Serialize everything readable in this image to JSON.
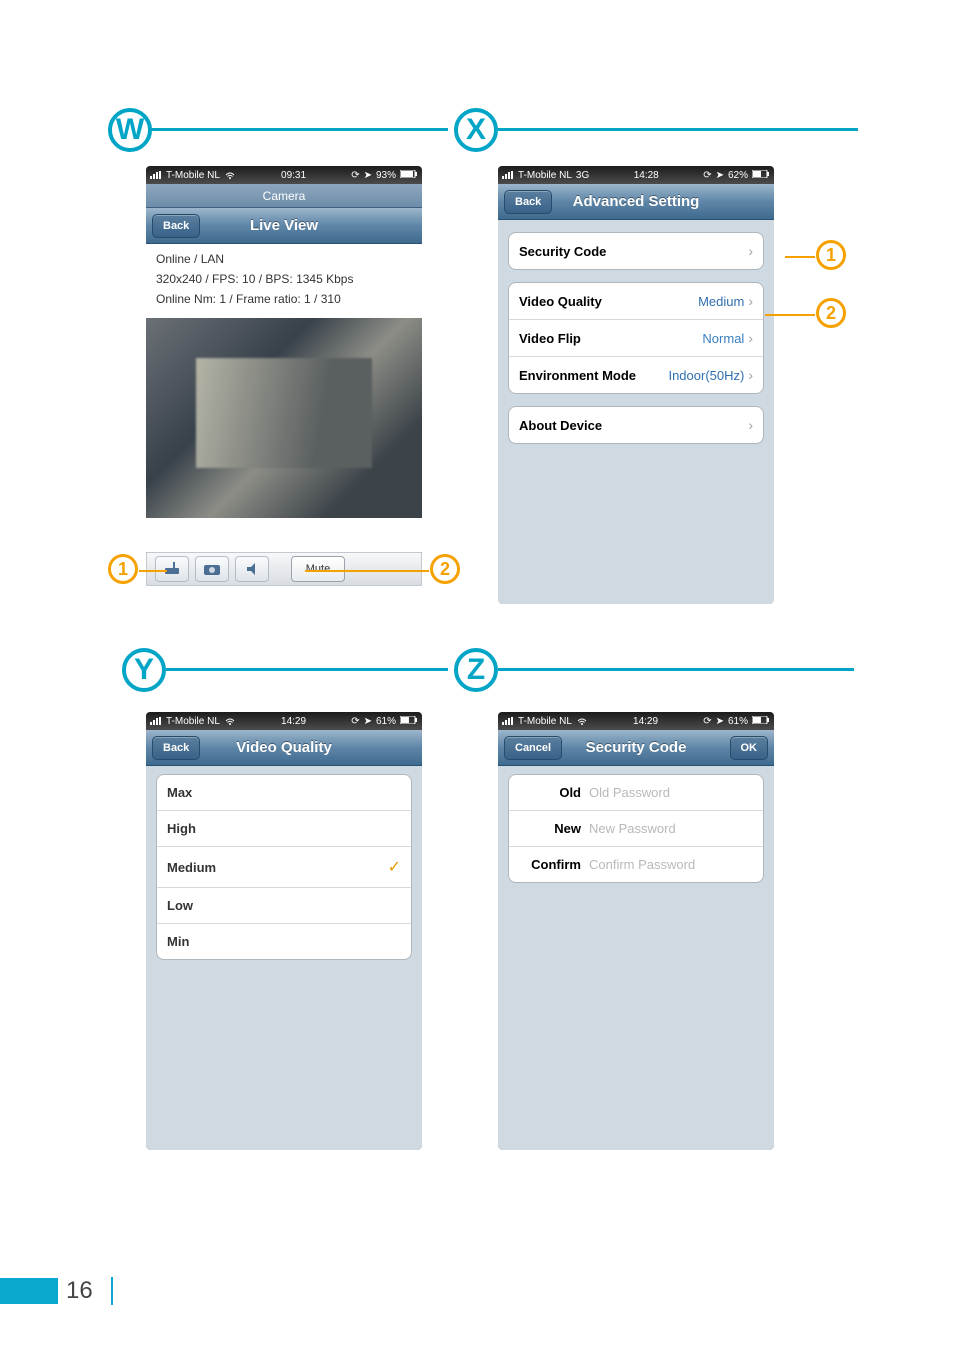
{
  "page_number": "16",
  "section_labels": {
    "w": "W",
    "x": "X",
    "y": "Y",
    "z": "Z"
  },
  "callouts": {
    "w1": "1",
    "w2": "2",
    "x1": "1",
    "x2": "2"
  },
  "panel_w": {
    "status": {
      "carrier": "T-Mobile NL",
      "network": "",
      "time": "09:31",
      "battery": "93%"
    },
    "subheader": "Camera",
    "back": "Back",
    "title": "Live View",
    "meta1": "Online / LAN",
    "meta2": "320x240 / FPS: 10 / BPS: 1345 Kbps",
    "meta3": "Online Nm: 1 / Frame ratio: 1 / 310",
    "toolbar": {
      "mute": "Mute"
    }
  },
  "panel_x": {
    "status": {
      "carrier": "T-Mobile NL",
      "network": "3G",
      "time": "14:28",
      "battery": "62%"
    },
    "back": "Back",
    "title": "Advanced Setting",
    "rows": {
      "security_code": "Security Code",
      "video_quality": {
        "label": "Video Quality",
        "value": "Medium"
      },
      "video_flip": {
        "label": "Video Flip",
        "value": "Normal"
      },
      "env_mode": {
        "label": "Environment Mode",
        "value": "Indoor(50Hz)"
      },
      "about": "About Device"
    }
  },
  "panel_y": {
    "status": {
      "carrier": "T-Mobile NL",
      "network": "",
      "time": "14:29",
      "battery": "61%"
    },
    "back": "Back",
    "title": "Video Quality",
    "options": [
      "Max",
      "High",
      "Medium",
      "Low",
      "Min"
    ],
    "selected_index": 2
  },
  "panel_z": {
    "status": {
      "carrier": "T-Mobile NL",
      "network": "",
      "time": "14:29",
      "battery": "61%"
    },
    "cancel": "Cancel",
    "ok": "OK",
    "title": "Security Code",
    "fields": {
      "old": {
        "label": "Old",
        "placeholder": "Old Password"
      },
      "new": {
        "label": "New",
        "placeholder": "New Password"
      },
      "confirm": {
        "label": "Confirm",
        "placeholder": "Confirm Password"
      }
    }
  }
}
